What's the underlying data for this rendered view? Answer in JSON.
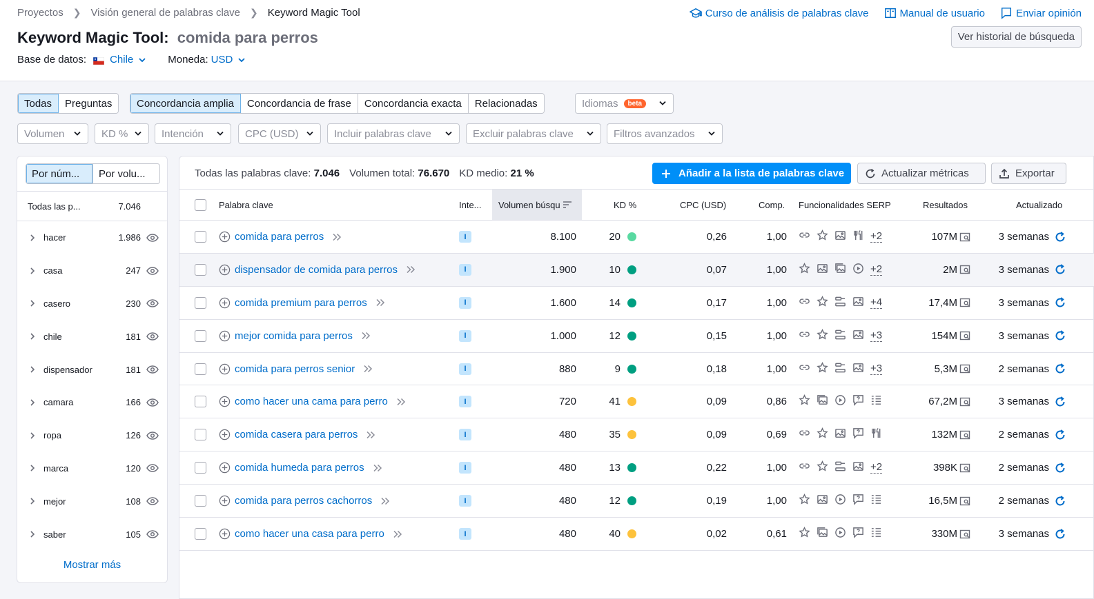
{
  "breadcrumb": [
    "Proyectos",
    "Visión general de palabras clave",
    "Keyword Magic Tool"
  ],
  "top_links": {
    "course": "Curso de análisis de palabras clave",
    "manual": "Manual de usuario",
    "feedback": "Enviar opinión"
  },
  "title": {
    "tool": "Keyword Magic Tool:",
    "query": "comida para perros"
  },
  "history_button": "Ver historial de búsqueda",
  "database": {
    "label": "Base de datos:",
    "value": "Chile"
  },
  "currency": {
    "label": "Moneda:",
    "value": "USD"
  },
  "tabs_type": [
    "Todas",
    "Preguntas"
  ],
  "tabs_match": [
    "Concordancia amplia",
    "Concordancia de frase",
    "Concordancia exacta",
    "Relacionadas"
  ],
  "languages": {
    "label": "Idiomas",
    "badge": "beta"
  },
  "filters": [
    "Volumen",
    "KD %",
    "Intención",
    "CPC (USD)",
    "Incluir palabras clave",
    "Excluir palabras clave",
    "Filtros avanzados"
  ],
  "left_panel": {
    "toggle": [
      "Por núm...",
      "Por volu..."
    ],
    "all_label": "Todas las p...",
    "all_count": "7.046",
    "groups": [
      {
        "label": "hacer",
        "count": "1.986"
      },
      {
        "label": "casa",
        "count": "247"
      },
      {
        "label": "casero",
        "count": "230"
      },
      {
        "label": "chile",
        "count": "181"
      },
      {
        "label": "dispensador",
        "count": "181"
      },
      {
        "label": "camara",
        "count": "166"
      },
      {
        "label": "ropa",
        "count": "126"
      },
      {
        "label": "marca",
        "count": "120"
      },
      {
        "label": "mejor",
        "count": "108"
      },
      {
        "label": "saber",
        "count": "105"
      }
    ],
    "show_more": "Mostrar más"
  },
  "stats": {
    "all_label": "Todas las palabras clave:",
    "all_value": "7.046",
    "volume_label": "Volumen total:",
    "volume_value": "76.670",
    "kd_label": "KD medio:",
    "kd_value": "21 %"
  },
  "actions": {
    "add": "Añadir a la lista de palabras clave",
    "update": "Actualizar métricas",
    "export": "Exportar"
  },
  "columns": [
    "Palabra clave",
    "Inte...",
    "Volumen búsqu",
    "KD %",
    "CPC (USD)",
    "Comp.",
    "Funcionalidades SERP",
    "Resultados",
    "Actualizado"
  ],
  "colors": {
    "accent": "#006dca",
    "kd_easy": "#7ee0a9",
    "kd_possible": "#009f81",
    "kd_hard": "#fdc23c"
  },
  "rows": [
    {
      "keyword": "comida para perros",
      "intent": "I",
      "volume": "8.100",
      "kd": "20",
      "kd_color": "#59d9a1",
      "cpc": "0,26",
      "comp": "1,00",
      "serp": [
        "link-icon",
        "star-icon",
        "image-icon",
        "recipe-icon"
      ],
      "serp_more": "+2",
      "results": "107M",
      "updated": "3 semanas",
      "highlight": false
    },
    {
      "keyword": "dispensador de comida para perros",
      "intent": "I",
      "volume": "1.900",
      "kd": "10",
      "kd_color": "#009f81",
      "cpc": "0,07",
      "comp": "1,00",
      "serp": [
        "star-icon",
        "image-icon",
        "image-pack-icon",
        "video-icon"
      ],
      "serp_more": "+2",
      "results": "2M",
      "updated": "3 semanas",
      "highlight": true
    },
    {
      "keyword": "comida premium para perros",
      "intent": "I",
      "volume": "1.600",
      "kd": "14",
      "kd_color": "#009f81",
      "cpc": "0,17",
      "comp": "1,00",
      "serp": [
        "link-icon",
        "star-icon",
        "shopping-icon",
        "image-icon"
      ],
      "serp_more": "+4",
      "results": "17,4M",
      "updated": "3 semanas",
      "highlight": false
    },
    {
      "keyword": "mejor comida para perros",
      "intent": "I",
      "volume": "1.000",
      "kd": "12",
      "kd_color": "#009f81",
      "cpc": "0,15",
      "comp": "1,00",
      "serp": [
        "link-icon",
        "star-icon",
        "shopping-icon",
        "image-icon"
      ],
      "serp_more": "+3",
      "results": "154M",
      "updated": "3 semanas",
      "highlight": false
    },
    {
      "keyword": "comida para perros senior",
      "intent": "I",
      "volume": "880",
      "kd": "9",
      "kd_color": "#009f81",
      "cpc": "0,18",
      "comp": "1,00",
      "serp": [
        "link-icon",
        "star-icon",
        "shopping-icon",
        "image-icon"
      ],
      "serp_more": "+3",
      "results": "5,3M",
      "updated": "2 semanas",
      "highlight": false
    },
    {
      "keyword": "como hacer una cama para perro",
      "intent": "I",
      "volume": "720",
      "kd": "41",
      "kd_color": "#fdc23c",
      "cpc": "0,09",
      "comp": "0,86",
      "serp": [
        "star-icon",
        "image-pack-icon",
        "video-icon",
        "faq-icon",
        "list-icon"
      ],
      "serp_more": "",
      "results": "67,2M",
      "updated": "3 semanas",
      "highlight": false
    },
    {
      "keyword": "comida casera para perros",
      "intent": "I",
      "volume": "480",
      "kd": "35",
      "kd_color": "#fdc23c",
      "cpc": "0,09",
      "comp": "0,69",
      "serp": [
        "link-icon",
        "star-icon",
        "image-icon",
        "faq-icon",
        "recipe-icon"
      ],
      "serp_more": "",
      "results": "132M",
      "updated": "2 semanas",
      "highlight": false
    },
    {
      "keyword": "comida humeda para perros",
      "intent": "I",
      "volume": "480",
      "kd": "13",
      "kd_color": "#009f81",
      "cpc": "0,22",
      "comp": "1,00",
      "serp": [
        "link-icon",
        "star-icon",
        "shopping-icon",
        "image-icon"
      ],
      "serp_more": "+2",
      "results": "398K",
      "updated": "2 semanas",
      "highlight": false
    },
    {
      "keyword": "comida para perros cachorros",
      "intent": "I",
      "volume": "480",
      "kd": "12",
      "kd_color": "#009f81",
      "cpc": "0,19",
      "comp": "1,00",
      "serp": [
        "star-icon",
        "image-icon",
        "video-icon",
        "faq-icon",
        "list-icon"
      ],
      "serp_more": "",
      "results": "16,5M",
      "updated": "2 semanas",
      "highlight": false
    },
    {
      "keyword": "como hacer una casa para perro",
      "intent": "I",
      "volume": "480",
      "kd": "40",
      "kd_color": "#fdc23c",
      "cpc": "0,02",
      "comp": "0,61",
      "serp": [
        "star-icon",
        "image-pack-icon",
        "video-icon",
        "faq-icon",
        "list-icon"
      ],
      "serp_more": "",
      "results": "330M",
      "updated": "3 semanas",
      "highlight": false
    }
  ]
}
